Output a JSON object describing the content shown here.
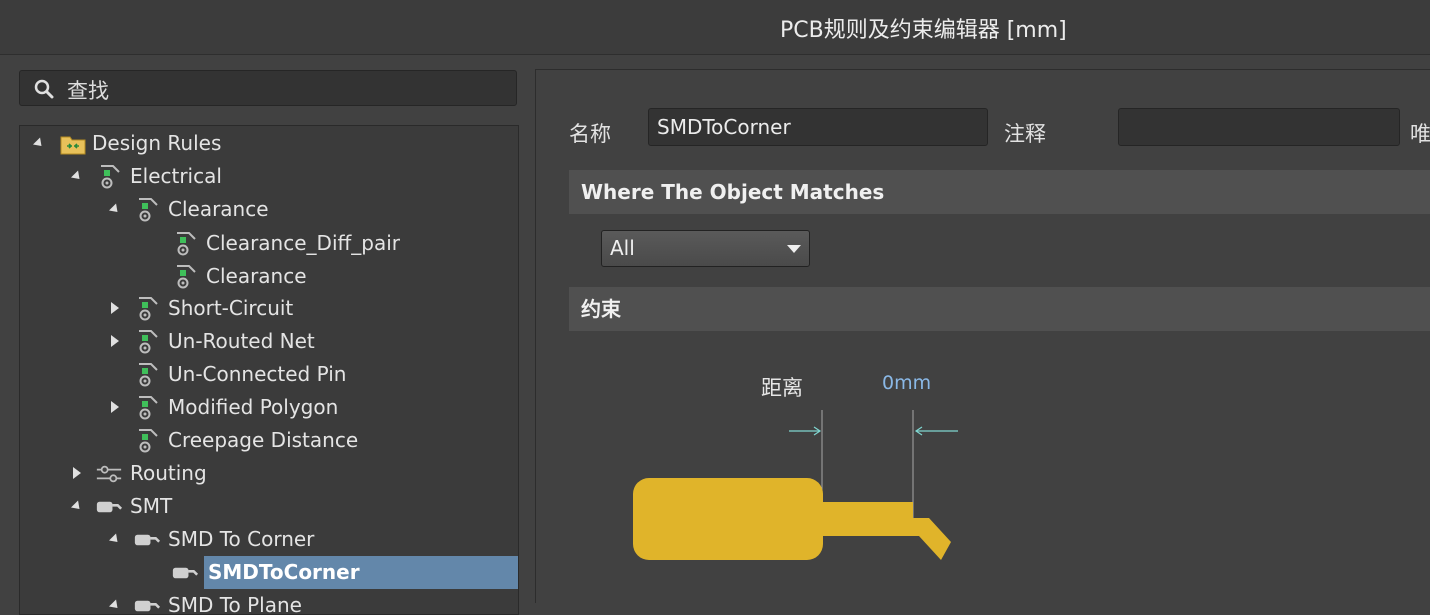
{
  "window": {
    "title": "PCB规则及约束编辑器 [mm]"
  },
  "search": {
    "placeholder": "查找",
    "icon": "search-icon"
  },
  "tree": {
    "items": [
      {
        "label": "Design Rules",
        "level": 0,
        "expanded": true,
        "icon": "folder-rules-icon"
      },
      {
        "label": "Electrical",
        "level": 1,
        "expanded": true,
        "icon": "rule-icon"
      },
      {
        "label": "Clearance",
        "level": 2,
        "expanded": true,
        "icon": "rule-icon"
      },
      {
        "label": "Clearance_Diff_pair",
        "level": 3,
        "icon": "rule-icon"
      },
      {
        "label": "Clearance",
        "level": 3,
        "icon": "rule-icon"
      },
      {
        "label": "Short-Circuit",
        "level": 2,
        "expanded": false,
        "icon": "rule-icon"
      },
      {
        "label": "Un-Routed Net",
        "level": 2,
        "expanded": false,
        "icon": "rule-icon"
      },
      {
        "label": "Un-Connected Pin",
        "level": 2,
        "icon": "rule-icon"
      },
      {
        "label": "Modified Polygon",
        "level": 2,
        "expanded": false,
        "icon": "rule-icon"
      },
      {
        "label": "Creepage Distance",
        "level": 2,
        "icon": "rule-icon"
      },
      {
        "label": "Routing",
        "level": 1,
        "expanded": false,
        "icon": "routing-icon"
      },
      {
        "label": "SMT",
        "level": 1,
        "expanded": true,
        "icon": "smt-icon"
      },
      {
        "label": "SMD To Corner",
        "level": 2,
        "expanded": true,
        "icon": "smt-icon"
      },
      {
        "label": "SMDToCorner",
        "level": 3,
        "selected": true,
        "icon": "smt-icon"
      },
      {
        "label": "SMD To Plane",
        "level": 2,
        "expanded": true,
        "icon": "smt-icon"
      }
    ]
  },
  "editor": {
    "name_label": "名称",
    "name_value": "SMDToCorner",
    "comment_label": "注释",
    "comment_value": "",
    "cut_label": "唯",
    "match_header": "Where The Object Matches",
    "match_select": "All",
    "constraints_header": "约束",
    "distance_label": "距离",
    "distance_value": "0mm"
  },
  "colors": {
    "pad": "#e0b42a",
    "selection": "#6387aa",
    "dimension": "#7fd6d0",
    "value_text": "#8ab8e6"
  }
}
